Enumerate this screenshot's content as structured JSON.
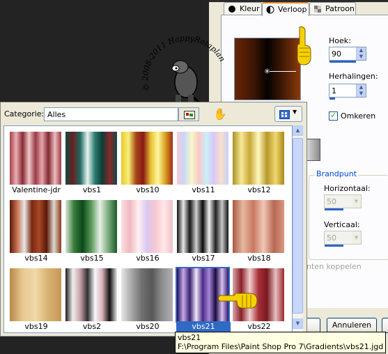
{
  "dialog": {
    "tabs": [
      {
        "label": "Kleur",
        "icon": "black-circle-icon"
      },
      {
        "label": "Verloop",
        "icon": "half-circle-icon",
        "active": true
      },
      {
        "label": "Patroon",
        "icon": "pattern-icon"
      }
    ],
    "hoek_label": "Hoek:",
    "hoek_value": "90",
    "herhalingen_label": "Herhalingen:",
    "herhalingen_value": "1",
    "omkeren_label": "Omkeren",
    "omkeren_checked": true,
    "brandpunt_label": "Brandpunt",
    "horizontaal_label": "Horizontaal:",
    "horizontaal_value": "50",
    "verticaal_label": "Verticaal:",
    "verticaal_value": "50",
    "koppelen_label": "nten koppelen",
    "annuleren_label": "Annuleren"
  },
  "popup": {
    "category_label": "Categorie:",
    "category_value": "Alles",
    "gradients": [
      {
        "name": "Valentine-jdr"
      },
      {
        "name": "vbs1"
      },
      {
        "name": "vbs10"
      },
      {
        "name": "vbs11"
      },
      {
        "name": "vbs12"
      },
      {
        "name": "vbs14"
      },
      {
        "name": "vbs15"
      },
      {
        "name": "vbs16"
      },
      {
        "name": "vbs17"
      },
      {
        "name": "vbs18"
      },
      {
        "name": "vbs19"
      },
      {
        "name": "vbs2"
      },
      {
        "name": "vbs20"
      },
      {
        "name": "vbs21",
        "selected": true
      },
      {
        "name": "vbs22"
      }
    ]
  },
  "tooltip": {
    "name": "vbs21",
    "path": "F:\\Program Files\\Paint Shop Pro 7\\Gradients\\vbs21.jgd"
  },
  "watermark": {
    "text_top": "© 2008-2011  HappyRataplan",
    "text_bottom": "HappyRataplan  2008-2011"
  },
  "colors": {
    "accent": "#316ac5",
    "tab_highlight": "#e68b2c",
    "dialog_bg": "#ece9d8",
    "desktop_bg": "#232323"
  }
}
